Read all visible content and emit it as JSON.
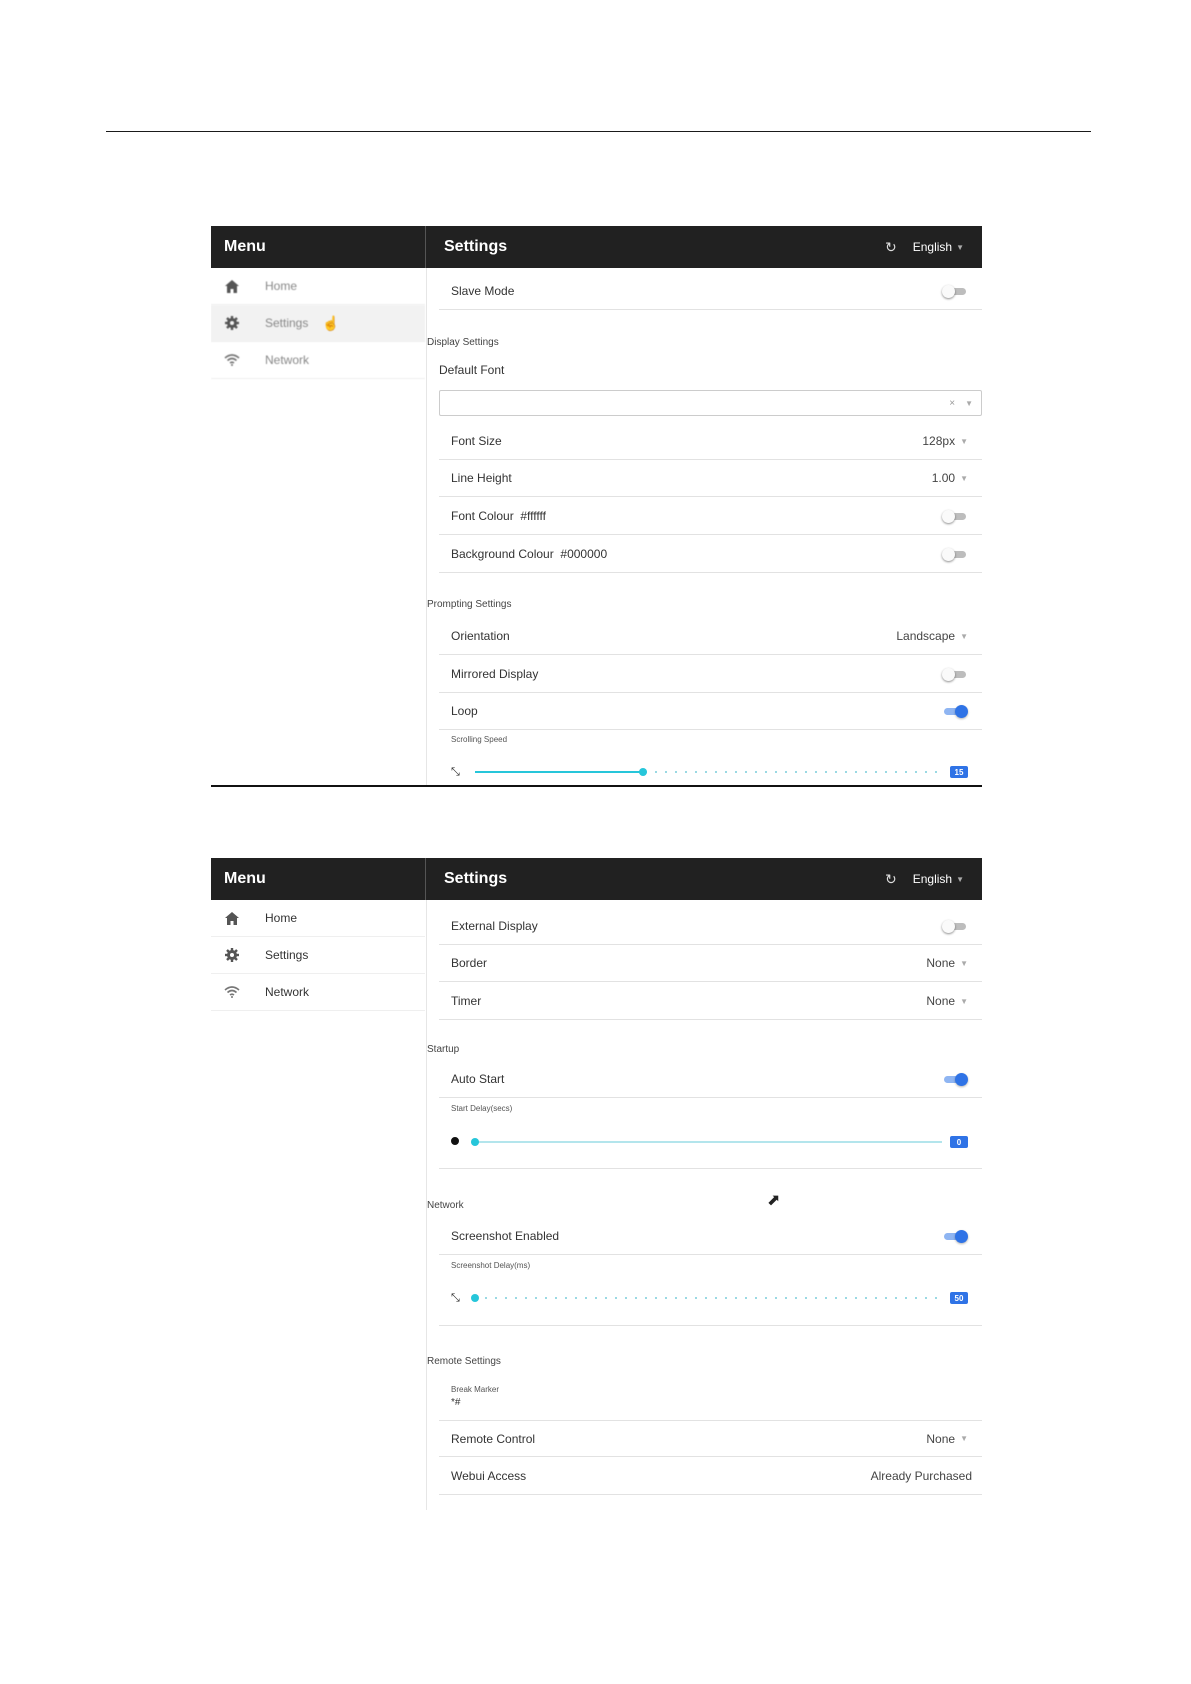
{
  "menu_title": "Menu",
  "settings_title": "Settings",
  "language": "English",
  "icons": {
    "home": "home-icon",
    "settings": "gear-icon",
    "network": "wifi-icon",
    "refresh": "refresh-icon",
    "pointer": "hand-pointer-icon",
    "cursor": "arrow-cursor-icon",
    "expand": "expand-icon",
    "stop": "stop-icon"
  },
  "colors": {
    "header_bg": "#212121",
    "toggle_on": "#2f73e6",
    "slider": "#26c6da"
  },
  "sidebar": [
    {
      "label": "Home"
    },
    {
      "label": "Settings"
    },
    {
      "label": "Network"
    }
  ],
  "screen1": {
    "slave_mode": {
      "label": "Slave Mode",
      "on": false
    },
    "display_settings": "Display Settings",
    "default_font": {
      "label": "Default Font",
      "value": "",
      "clear": "×"
    },
    "font_size": {
      "label": "Font Size",
      "value": "128px"
    },
    "line_height": {
      "label": "Line Height",
      "value": "1.00"
    },
    "font_colour": {
      "label": "Font Colour",
      "value": "#ffffff",
      "on": false
    },
    "background_colour": {
      "label": "Background Colour",
      "value": "#000000",
      "on": false
    },
    "prompting_settings": "Prompting Settings",
    "orientation": {
      "label": "Orientation",
      "value": "Landscape"
    },
    "mirrored_display": {
      "label": "Mirrored Display",
      "on": false
    },
    "loop": {
      "label": "Loop",
      "on": true
    },
    "scrolling_speed": {
      "label": "Scrolling Speed",
      "value": "15",
      "fraction": 0.36
    }
  },
  "screen2": {
    "external_display": {
      "label": "External Display",
      "on": false
    },
    "border": {
      "label": "Border",
      "value": "None"
    },
    "timer": {
      "label": "Timer",
      "value": "None"
    },
    "startup": "Startup",
    "auto_start": {
      "label": "Auto Start",
      "on": true
    },
    "start_delay": {
      "label": "Start Delay(secs)",
      "value": "0",
      "fraction": 0
    },
    "network": "Network",
    "screenshot_enabled": {
      "label": "Screenshot Enabled",
      "on": true
    },
    "screenshot_delay": {
      "label": "Screenshot Delay(ms)",
      "value": "50",
      "fraction": 0
    },
    "remote_settings": "Remote Settings",
    "break_marker": {
      "label": "Break Marker",
      "value": "*#"
    },
    "remote_control": {
      "label": "Remote Control",
      "value": "None"
    },
    "webui_access": {
      "label": "Webui Access",
      "value": "Already Purchased"
    }
  }
}
